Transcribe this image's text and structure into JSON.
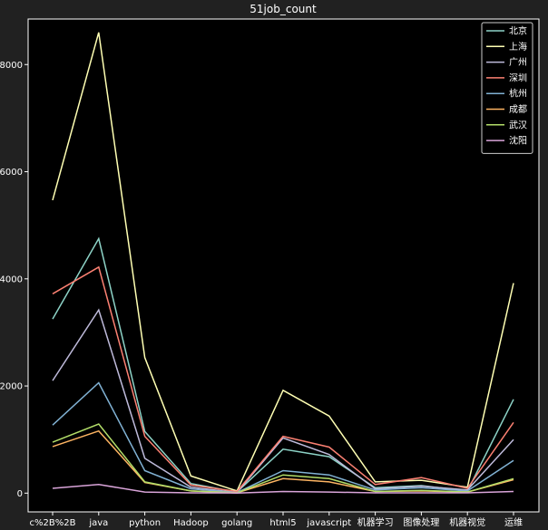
{
  "chart_data": {
    "type": "line",
    "title": "51job_count",
    "xlabel": "",
    "ylabel": "",
    "categories": [
      "c%2B%2B",
      "java",
      "python",
      "Hadoop",
      "golang",
      "html5",
      "javascript",
      "机器学习",
      "图像处理",
      "机器视觉",
      "运维"
    ],
    "ylim": [
      -350,
      8850
    ],
    "yticks": [
      0,
      2000,
      4000,
      6000,
      8000
    ],
    "grid": false,
    "legend_position": "top-right",
    "series": [
      {
        "name": "北京",
        "color": "#8dd3c7",
        "values": [
          3250,
          4750,
          1150,
          180,
          20,
          820,
          680,
          100,
          140,
          40,
          1750
        ]
      },
      {
        "name": "上海",
        "color": "#ffffb3",
        "values": [
          5470,
          8600,
          2530,
          320,
          40,
          1920,
          1440,
          210,
          240,
          110,
          3920
        ]
      },
      {
        "name": "广州",
        "color": "#bebada",
        "values": [
          2100,
          3420,
          650,
          110,
          10,
          1030,
          720,
          80,
          130,
          60,
          1000
        ]
      },
      {
        "name": "深圳",
        "color": "#fb8072",
        "values": [
          3720,
          4220,
          1060,
          150,
          30,
          1060,
          860,
          160,
          290,
          90,
          1320
        ]
      },
      {
        "name": "杭州",
        "color": "#80b1d3",
        "values": [
          1270,
          2060,
          420,
          80,
          10,
          420,
          340,
          60,
          100,
          40,
          610
        ]
      },
      {
        "name": "成都",
        "color": "#fdb462",
        "values": [
          870,
          1160,
          200,
          40,
          5,
          270,
          210,
          30,
          40,
          20,
          250
        ]
      },
      {
        "name": "武汉",
        "color": "#b3de69",
        "values": [
          950,
          1290,
          210,
          40,
          5,
          340,
          270,
          30,
          50,
          20,
          270
        ]
      },
      {
        "name": "沈阳",
        "color": "#d9a4d9",
        "values": [
          90,
          160,
          20,
          5,
          2,
          30,
          20,
          5,
          5,
          5,
          30
        ]
      }
    ]
  }
}
